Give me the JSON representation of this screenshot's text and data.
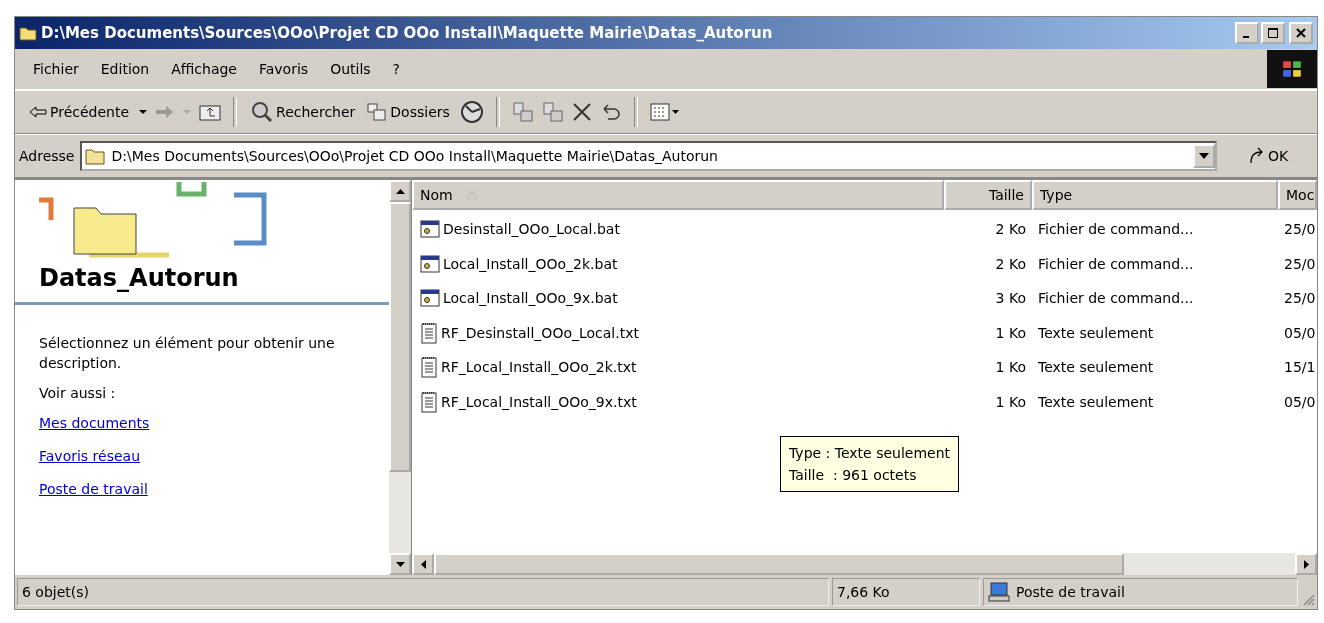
{
  "window": {
    "title": "D:\\Mes Documents\\Sources\\OOo\\Projet CD OOo Install\\Maquette Mairie\\Datas_Autorun"
  },
  "menu": [
    "Fichier",
    "Edition",
    "Affichage",
    "Favoris",
    "Outils",
    "?"
  ],
  "toolbar": {
    "back": "Précédente",
    "search": "Rechercher",
    "folders": "Dossiers"
  },
  "address": {
    "label": "Adresse",
    "value": "D:\\Mes Documents\\Sources\\OOo\\Projet CD OOo Install\\Maquette Mairie\\Datas_Autorun",
    "go": "OK"
  },
  "side_panel": {
    "title": "Datas_Autorun",
    "description": "Sélectionnez un élément pour obtenir une description.",
    "see_also": "Voir aussi :",
    "links": [
      "Mes documents",
      "Favoris réseau",
      "Poste de travail"
    ]
  },
  "table": {
    "columns": [
      "Nom",
      "Taille",
      "Type",
      "Moc"
    ],
    "rows": [
      {
        "kind": "bat",
        "name": "Desinstall_OOo_Local.bat",
        "size": "2 Ko",
        "type": "Fichier de command...",
        "modified": "25/0"
      },
      {
        "kind": "bat",
        "name": "Local_Install_OOo_2k.bat",
        "size": "2 Ko",
        "type": "Fichier de command...",
        "modified": "25/0"
      },
      {
        "kind": "bat",
        "name": "Local_Install_OOo_9x.bat",
        "size": "3 Ko",
        "type": "Fichier de command...",
        "modified": "25/0"
      },
      {
        "kind": "txt",
        "name": "RF_Desinstall_OOo_Local.txt",
        "size": "1 Ko",
        "type": "Texte seulement",
        "modified": "05/0"
      },
      {
        "kind": "txt",
        "name": "RF_Local_Install_OOo_2k.txt",
        "size": "1 Ko",
        "type": "Texte seulement",
        "modified": "15/1"
      },
      {
        "kind": "txt",
        "name": "RF_Local_Install_OOo_9x.txt",
        "size": "1 Ko",
        "type": "Texte seulement",
        "modified": "05/0"
      }
    ]
  },
  "tooltip": [
    "Type : Texte seulement",
    "Taille  : 961 octets"
  ],
  "status_bar": {
    "count": "6 objet(s)",
    "size": "7,66 Ko",
    "zone": "Poste de travail"
  }
}
